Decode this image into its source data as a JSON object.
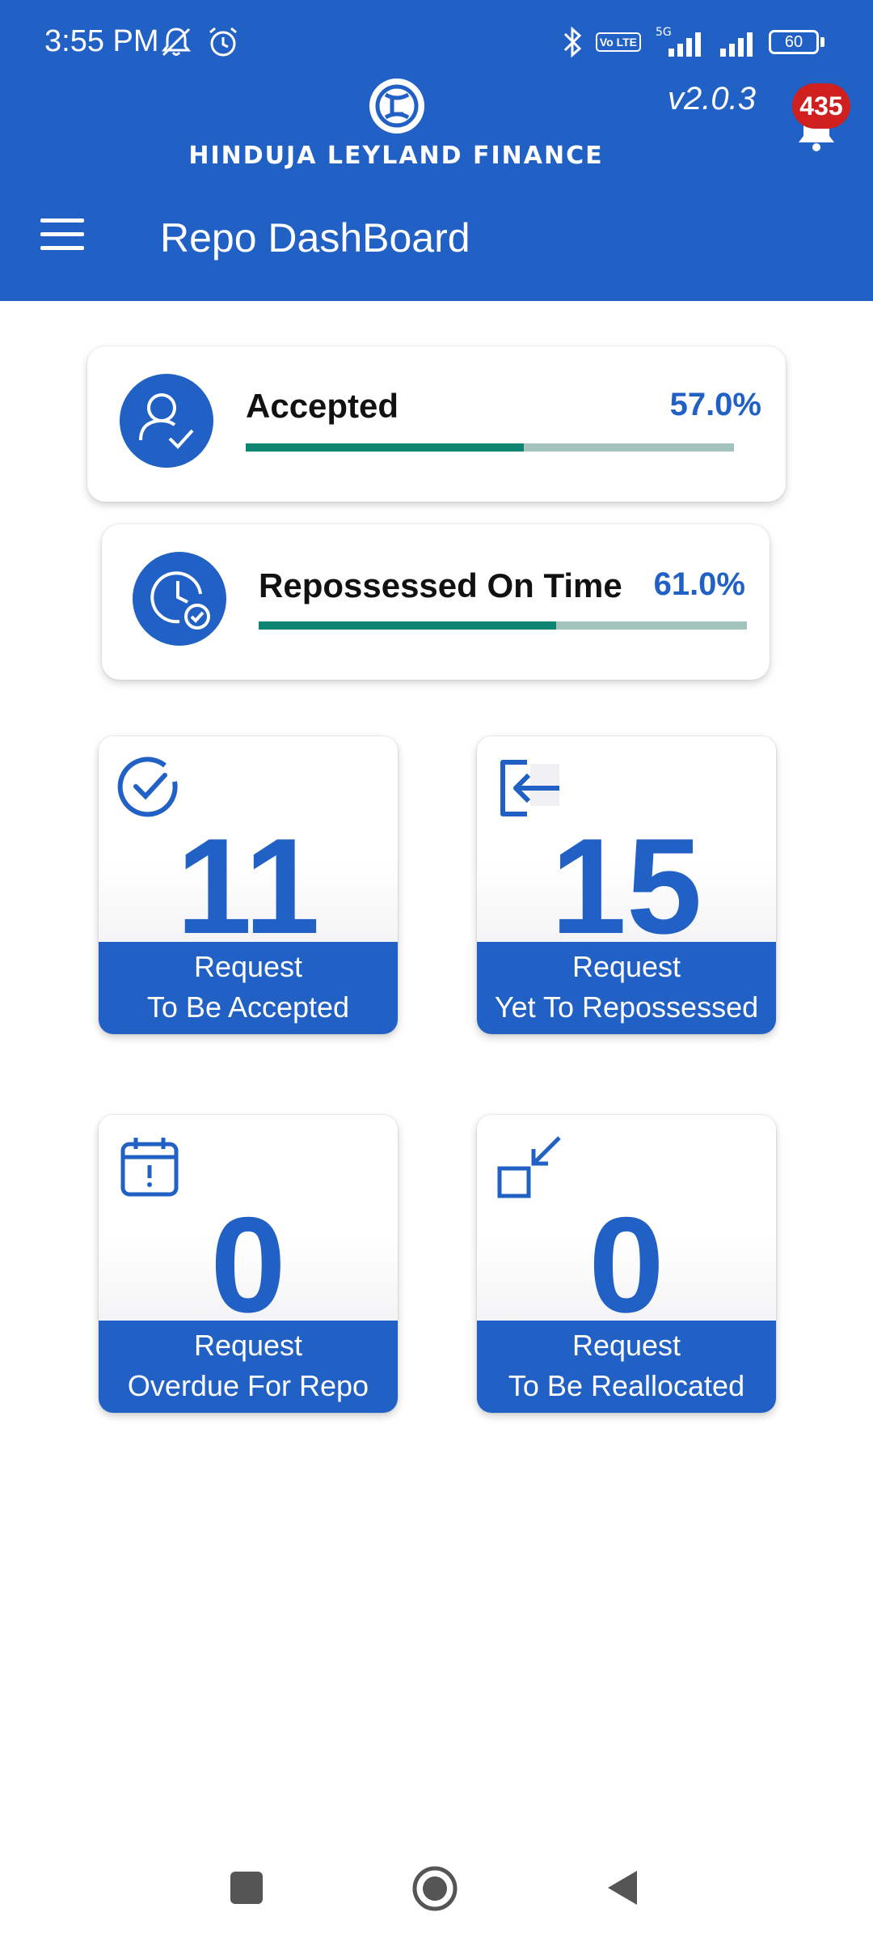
{
  "status_bar": {
    "time": "3:55 PM",
    "left_icons": [
      "mute-icon",
      "alarm-icon"
    ],
    "right_icons": [
      "bluetooth-icon",
      "volte-icon",
      "signal-5g-icon",
      "signal-icon"
    ],
    "volte_label": "Vo LTE",
    "network_label": "5G",
    "battery": "60"
  },
  "header": {
    "brand_name": "HINDUJA LEYLAND FINANCE",
    "version": "v2.0.3",
    "notification_count": "435",
    "title": "Repo DashBoard"
  },
  "progress_cards": [
    {
      "label": "Accepted",
      "value": "57.0%",
      "progress": 0.57,
      "icon": "user-check-icon"
    },
    {
      "label": "Repossessed On Time",
      "value": "61.0%",
      "progress": 0.61,
      "icon": "clock-check-icon"
    }
  ],
  "tiles": [
    {
      "count": "11",
      "line1": "Request",
      "line2": "To Be Accepted",
      "icon": "check-circle-icon"
    },
    {
      "count": "15",
      "line1": "Request",
      "line2": "Yet To Repossessed",
      "icon": "sign-in-icon"
    },
    {
      "count": "0",
      "line1": "Request",
      "line2": "Overdue For Repo",
      "icon": "calendar-alert-icon"
    },
    {
      "count": "0",
      "line1": "Request",
      "line2": "To Be Reallocated",
      "icon": "arrow-into-box-icon"
    }
  ],
  "colors": {
    "primary": "#2160c4",
    "progress_fill": "#0e8570",
    "progress_track": "#a3c4bd",
    "badge": "#cf1f1f"
  },
  "nav_bar": {
    "buttons": [
      "recents-button",
      "home-button",
      "back-button"
    ]
  }
}
